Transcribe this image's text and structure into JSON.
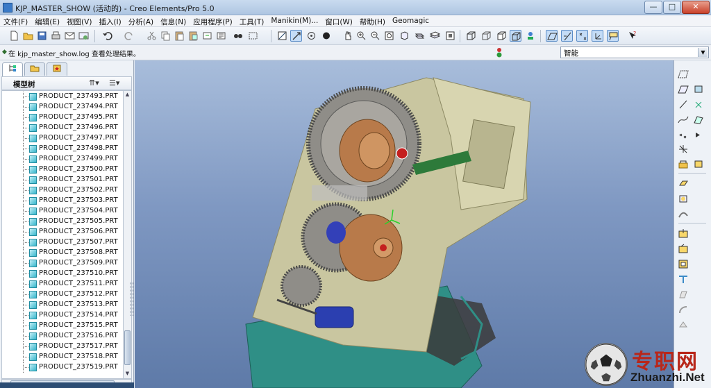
{
  "window": {
    "title": "KJP_MASTER_SHOW (活动的) - Creo Elements/Pro 5.0",
    "min_label": "—",
    "max_label": "□",
    "close_label": "✕"
  },
  "menu": [
    "文件(F)",
    "编辑(E)",
    "视图(V)",
    "插入(I)",
    "分析(A)",
    "信息(N)",
    "应用程序(P)",
    "工具(T)",
    "Manikin(M)...",
    "窗口(W)",
    "帮助(H)",
    "Geomagic"
  ],
  "status": {
    "message": "在 kjp_master_show.log 查看处理结果。",
    "filter_value": "智能"
  },
  "model_tree": {
    "header": "模型树",
    "items": [
      "PRODUCT_237493.PRT",
      "PRODUCT_237494.PRT",
      "PRODUCT_237495.PRT",
      "PRODUCT_237496.PRT",
      "PRODUCT_237497.PRT",
      "PRODUCT_237498.PRT",
      "PRODUCT_237499.PRT",
      "PRODUCT_237500.PRT",
      "PRODUCT_237501.PRT",
      "PRODUCT_237502.PRT",
      "PRODUCT_237503.PRT",
      "PRODUCT_237504.PRT",
      "PRODUCT_237505.PRT",
      "PRODUCT_237506.PRT",
      "PRODUCT_237507.PRT",
      "PRODUCT_237508.PRT",
      "PRODUCT_237509.PRT",
      "PRODUCT_237510.PRT",
      "PRODUCT_237511.PRT",
      "PRODUCT_237512.PRT",
      "PRODUCT_237513.PRT",
      "PRODUCT_237514.PRT",
      "PRODUCT_237515.PRT",
      "PRODUCT_237516.PRT",
      "PRODUCT_237517.PRT",
      "PRODUCT_237518.PRT",
      "PRODUCT_237519.PRT"
    ]
  },
  "watermark": {
    "title": "专职网",
    "site": "Zhuanzhi.Net"
  },
  "colors": {
    "viewport_top": "#a8bddb",
    "viewport_bottom": "#5e7aa8",
    "frame": "#c9c6a0",
    "base": "#2f8f86",
    "wheel": "#b87a4a",
    "motor": "#2b3fb0",
    "watermark_red": "#b8271a"
  }
}
